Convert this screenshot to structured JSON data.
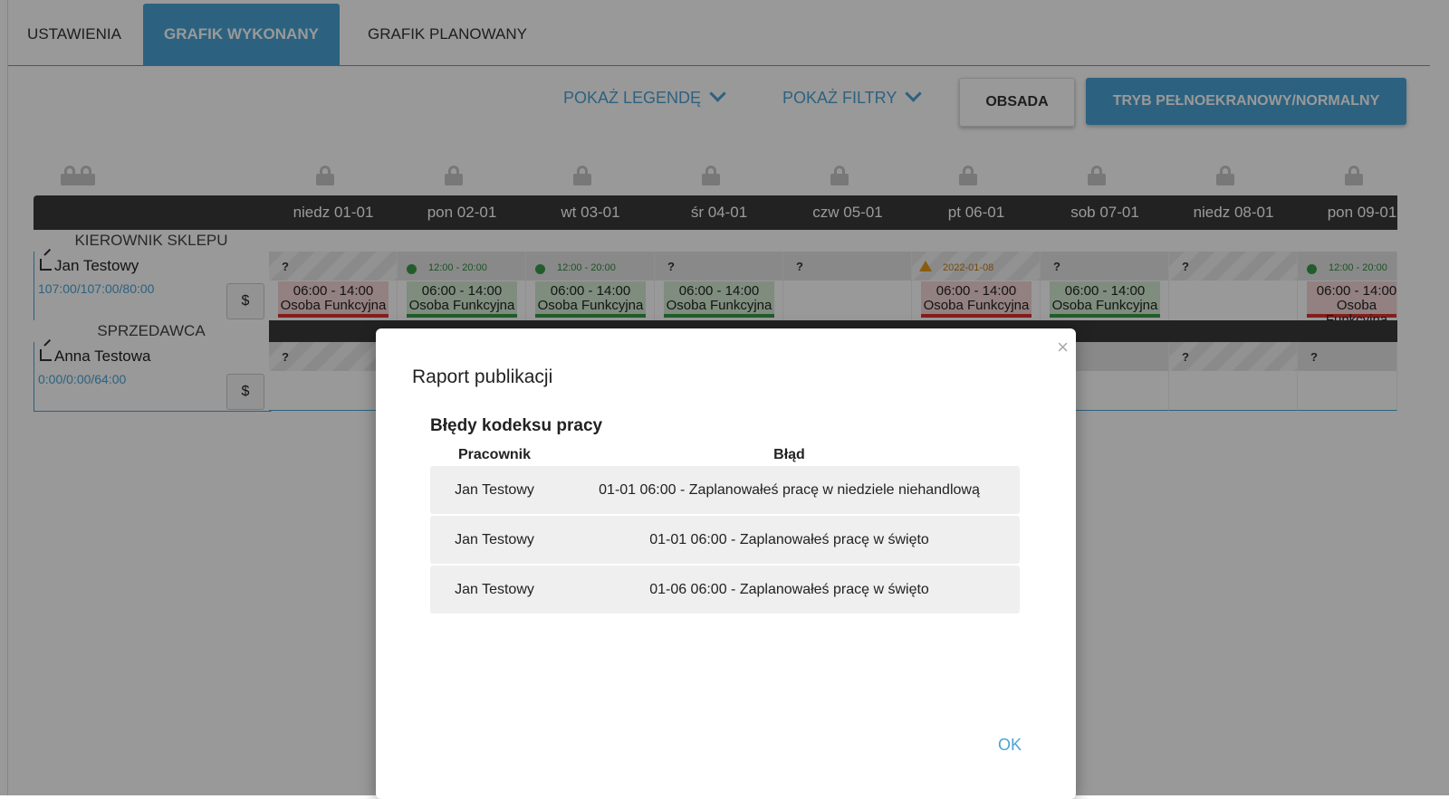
{
  "tabs": [
    {
      "label": "USTAWIENIA",
      "active": false
    },
    {
      "label": "GRAFIK WYKONANY",
      "active": true
    },
    {
      "label": "GRAFIK PLANOWANY",
      "active": false
    }
  ],
  "toolbar": {
    "show_legend": "POKAŻ LEGENDĘ",
    "show_filters": "POKAŻ FILTRY",
    "staffing": "OBSADA",
    "fullscreen": "TRYB PEŁNOEKRANOWY/NORMALNY"
  },
  "days": [
    "niedz 01-01",
    "pon 02-01",
    "wt 03-01",
    "śr 04-01",
    "czw 05-01",
    "pt 06-01",
    "sob 07-01",
    "niedz 08-01",
    "pon 09-01"
  ],
  "groups": [
    {
      "name": "KIEROWNIK SKLEPU",
      "employee": {
        "name": "Jan Testowy",
        "hours": "107:00/107:00/80:00",
        "dollar": "$",
        "cells": [
          {
            "status": "?",
            "shift": "06:00 - 14:00",
            "role": "Osoba Funkcyjna",
            "color": "red"
          },
          {
            "status": "12:00 - 20:00",
            "shift": "06:00 - 14:00",
            "role": "Osoba Funkcyjna",
            "color": "green"
          },
          {
            "status": "12:00 - 20:00",
            "shift": "06:00 - 14:00",
            "role": "Osoba Funkcyjna",
            "color": "green"
          },
          {
            "status": "?",
            "shift": "06:00 - 14:00",
            "role": "Osoba Funkcyjna",
            "color": "green"
          },
          {
            "status": "?"
          },
          {
            "status": "2022-01-08",
            "shift": "06:00 - 14:00",
            "role": "Osoba Funkcyjna",
            "color": "red"
          },
          {
            "status": "?",
            "shift": "06:00 - 14:00",
            "role": "Osoba Funkcyjna",
            "color": "green"
          },
          {
            "status": "?"
          },
          {
            "status": "12:00 - 20:00",
            "shift": "06:00 - 14:00",
            "role": "Osoba Funkcyjna",
            "color": "red"
          }
        ]
      }
    },
    {
      "name": "SPRZEDAWCA",
      "employee": {
        "name": "Anna Testowa",
        "hours": "0:00/0:00/64:00",
        "dollar": "$",
        "cells": [
          {
            "status": "?"
          },
          {
            "status": ""
          },
          {
            "status": ""
          },
          {
            "status": ""
          },
          {
            "status": ""
          },
          {
            "status": ""
          },
          {
            "status": ""
          },
          {
            "status": "?"
          },
          {
            "status": "?"
          }
        ]
      }
    }
  ],
  "modal": {
    "title": "Raport publikacji",
    "section_title": "Błędy kodeksu pracy",
    "columns": [
      "Pracownik",
      "Błąd"
    ],
    "rows": [
      {
        "employee": "Jan Testowy",
        "error": "01-01 06:00 - Zaplanowałeś pracę w niedziele niehandlową"
      },
      {
        "employee": "Jan Testowy",
        "error": "01-01 06:00 - Zaplanowałeś pracę w święto"
      },
      {
        "employee": "Jan Testowy",
        "error": "01-06 06:00 - Zaplanowałeś pracę w święto"
      }
    ],
    "ok_label": "OK",
    "close_icon": "×"
  },
  "colors": {
    "accent": "#4aa3d6",
    "header_dark": "#3a3a3a",
    "ok_green": "#3a9a48",
    "error_red": "#dd3333"
  }
}
